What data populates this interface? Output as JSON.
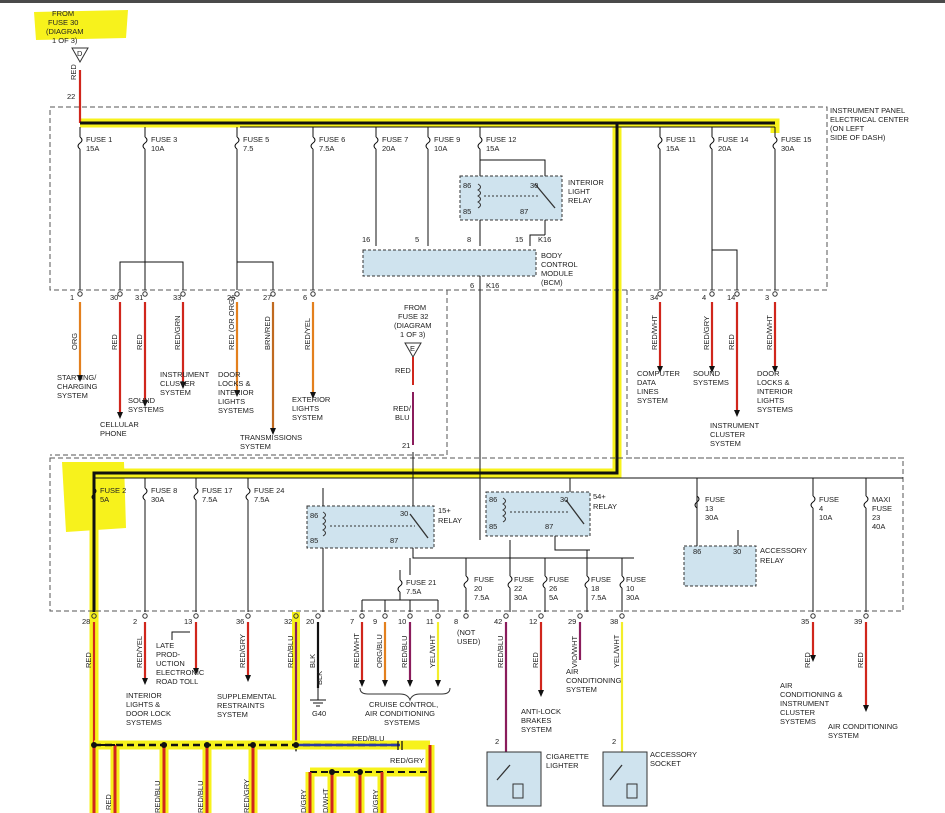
{
  "header": {
    "lines": [
      "FROM",
      "FUSE 30",
      "(DIAGRAM",
      "1 OF 3)"
    ],
    "connector": "D"
  },
  "top_splice": {
    "pin": "22",
    "wire": "RED"
  },
  "upper_box": {
    "lines": [
      "INSTRUMENT PANEL",
      "ELECTRICAL CENTER",
      "(ON LEFT",
      "SIDE OF DASH)"
    ]
  },
  "fuses_upper": [
    {
      "name": "FUSE 1",
      "rating": "15A"
    },
    {
      "name": "FUSE 3",
      "rating": "10A"
    },
    {
      "name": "FUSE 5",
      "rating": "7.5"
    },
    {
      "name": "FUSE 6",
      "rating": "7.5A"
    },
    {
      "name": "FUSE 7",
      "rating": "20A"
    },
    {
      "name": "FUSE 9",
      "rating": "10A"
    },
    {
      "name": "FUSE 12",
      "rating": "15A"
    },
    {
      "name": "FUSE 11",
      "rating": "15A"
    },
    {
      "name": "FUSE 14",
      "rating": "20A"
    },
    {
      "name": "FUSE 15",
      "rating": "30A"
    }
  ],
  "interior_relay": {
    "lines": [
      "INTERIOR",
      "LIGHT",
      "RELAY"
    ],
    "pins": [
      "86",
      "30",
      "85",
      "87"
    ]
  },
  "bcm": {
    "lines": [
      "BODY",
      "CONTROL",
      "MODULE",
      "(BCM)"
    ],
    "pins": [
      "16",
      "5",
      "8",
      "15"
    ],
    "conn": "K16",
    "out_pin": "6",
    "out_conn": "K16"
  },
  "upper_outputs": [
    {
      "pin": "1",
      "wire": "ORG",
      "lines": [
        "STARTING/",
        "CHARGING",
        "SYSTEM"
      ]
    },
    {
      "pin": "30",
      "wire": "RED",
      "lines": [
        "CELLULAR",
        "PHONE"
      ]
    },
    {
      "pin": "31",
      "wire": "RED",
      "lines": [
        "SOUND",
        "SYSTEMS"
      ]
    },
    {
      "pin": "33",
      "wire": "RED/GRN",
      "lines": [
        "INSTRUMENT",
        "CLUSTER",
        "SYSTEM"
      ]
    },
    {
      "pin": "26",
      "wire": "RED (OR ORG)",
      "lines": [
        "DOOR",
        "LOCKS &",
        "INTERIOR",
        "LIGHTS",
        "SYSTEMS"
      ]
    },
    {
      "pin": "27",
      "wire": "BRN/RED",
      "lines": [
        "TRANSMISSIONS",
        "SYSTEM"
      ]
    },
    {
      "pin": "6",
      "wire": "RED/YEL",
      "lines": [
        "EXTERIOR",
        "LIGHTS",
        "SYSTEM"
      ]
    },
    {
      "pin": "34",
      "wire": "RED/WHT",
      "lines": [
        "COMPUTER",
        "DATA",
        "LINES",
        "SYSTEM"
      ]
    },
    {
      "pin": "4",
      "wire": "RED/GRY",
      "lines": [
        "SOUND",
        "SYSTEMS"
      ]
    },
    {
      "pin": "14",
      "wire": "RED",
      "lines": [
        "INSTRUMENT",
        "CLUSTER",
        "SYSTEM"
      ]
    },
    {
      "pin": "3",
      "wire": "RED/WHT",
      "lines": [
        "DOOR",
        "LOCKS &",
        "INTERIOR",
        "LIGHTS",
        "SYSTEMS"
      ]
    }
  ],
  "fuse32_ref": {
    "lines": [
      "FROM",
      "FUSE 32",
      "(DIAGRAM",
      "1 OF 3)"
    ],
    "connector": "E",
    "wire1": "RED",
    "wire2": [
      "RED/",
      "BLU"
    ],
    "pin": "21"
  },
  "fuses_lower": [
    {
      "name": "FUSE 2",
      "rating": "5A"
    },
    {
      "name": "FUSE 8",
      "rating": "30A"
    },
    {
      "name": "FUSE 17",
      "rating": "7.5A"
    },
    {
      "name": "FUSE 24",
      "rating": "7.5A"
    },
    {
      "name": "FUSE 13",
      "rating": "30A"
    },
    {
      "name": "FUSE 4",
      "rating": "10A"
    },
    {
      "name": "MAXI FUSE 23",
      "rating": "40A"
    },
    {
      "name": "FUSE 21",
      "rating": "7.5A"
    },
    {
      "name": "FUSE 20",
      "rating": "7.5A"
    },
    {
      "name": "FUSE 22",
      "rating": "30A"
    },
    {
      "name": "FUSE 26",
      "rating": "5A"
    },
    {
      "name": "FUSE 18",
      "rating": "7.5A"
    },
    {
      "name": "FUSE 10",
      "rating": "30A"
    }
  ],
  "relays_lower": [
    {
      "name": [
        "15+",
        "RELAY"
      ],
      "pins": [
        "86",
        "30",
        "85",
        "87"
      ]
    },
    {
      "name": [
        "54+",
        "RELAY"
      ],
      "pins": [
        "86",
        "30",
        "85",
        "87"
      ]
    },
    {
      "name": [
        "ACCESSORY",
        "RELAY"
      ],
      "pins": [
        "86",
        "30"
      ]
    }
  ],
  "lower_outputs": [
    {
      "pin": "28",
      "wire": "RED"
    },
    {
      "pin": "2",
      "wire": "RED/YEL",
      "lines": [
        "INTERIOR",
        "LIGHTS &",
        "DOOR LOCK",
        "SYSTEMS"
      ]
    },
    {
      "pin": "13",
      "wire": "",
      "lines": [
        "LATE",
        "PROD-",
        "UCTION",
        "ELECTRONIC",
        "ROAD TOLL"
      ]
    },
    {
      "pin": "36",
      "wire": "RED/GRY",
      "lines": [
        "SUPPLEMENTAL",
        "RESTRAINTS",
        "SYSTEM"
      ]
    },
    {
      "pin": "32",
      "wire": "RED/BLU"
    },
    {
      "pin": "20",
      "wire": "BLK",
      "ground": "G40"
    },
    {
      "pin": "7",
      "wire": "RED/WHT"
    },
    {
      "pin": "9",
      "wire": "ORG/BLU"
    },
    {
      "pin": "10",
      "wire": "RED/BLU"
    },
    {
      "pin": "11",
      "wire": "YEL/WHT"
    },
    {
      "pin": "8",
      "wire": "",
      "lines": [
        "(NOT",
        "USED)"
      ]
    },
    {
      "pin": "42",
      "wire": "RED/BLU"
    },
    {
      "pin": "12",
      "wire": "RED",
      "lines": [
        "ANTI-LOCK",
        "BRAKES",
        "SYSTEM"
      ]
    },
    {
      "pin": "29",
      "wire": "VIO/WHT",
      "lines": [
        "AIR",
        "CONDITIONING",
        "SYSTEM"
      ]
    },
    {
      "pin": "38",
      "wire": "YEL/WHT"
    },
    {
      "pin": "35",
      "wire": "RED",
      "lines": [
        "AIR",
        "CONDITIONING &",
        "INSTRUMENT",
        "CLUSTER",
        "SYSTEMS"
      ]
    },
    {
      "pin": "39",
      "wire": "RED",
      "lines": [
        "AIR CONDITIONING",
        "SYSTEM"
      ]
    }
  ],
  "cruise_group": {
    "lines": [
      "CRUISE CONTROL,",
      "AIR CONDITIONING",
      "SYSTEMS"
    ]
  },
  "bottom": {
    "cig": {
      "pin": "2",
      "lines": [
        "CIGARETTE",
        "LIGHTER"
      ]
    },
    "acc": {
      "pin": "2",
      "lines": [
        "ACCESSORY",
        "SOCKET"
      ]
    },
    "bus_label1": "RED/BLU",
    "bus_label2": "RED/GRY",
    "wire_labels": [
      "RED",
      "RED/BLU",
      "RED/BLU",
      "RED/GRY",
      "D/GRY",
      "D/WHT",
      "D/GRY"
    ]
  },
  "colors": {
    "highlight": "#f7f21c",
    "red": "#d0261c",
    "orange": "#e3801e",
    "yellow": "#f3ee2a",
    "blue": "#2d3aa8",
    "purple": "#8a1c5c",
    "box_fill": "#cfe3ee"
  }
}
